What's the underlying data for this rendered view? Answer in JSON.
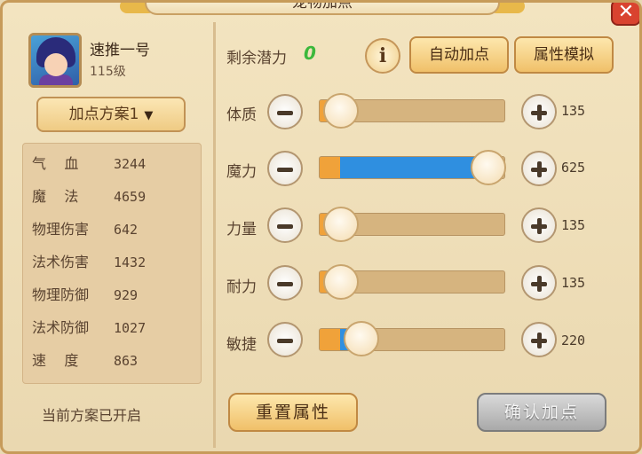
{
  "window": {
    "title": "宠物加点",
    "close_icon": "close-icon"
  },
  "pet": {
    "name": "速推一号",
    "level": "115级"
  },
  "scheme": {
    "label": "加点方案1"
  },
  "stats": [
    {
      "label": "气    血",
      "value": "3244"
    },
    {
      "label": "魔    法",
      "value": "4659"
    },
    {
      "label": "物理伤害",
      "value": "642"
    },
    {
      "label": "法术伤害",
      "value": "1432"
    },
    {
      "label": "物理防御",
      "value": "929"
    },
    {
      "label": "法术防御",
      "value": "1027"
    },
    {
      "label": "速    度",
      "value": "863"
    }
  ],
  "status_text": "当前方案已开启",
  "potential": {
    "label": "剩余潜力",
    "value": "0"
  },
  "buttons": {
    "info": "i",
    "auto": "自动加点",
    "simulate": "属性模拟",
    "reset": "重置属性",
    "confirm": "确认加点"
  },
  "attributes": [
    {
      "label": "体质",
      "value": "135",
      "base_fraction": 0.11,
      "added_fraction": 0.0
    },
    {
      "label": "魔力",
      "value": "625",
      "base_fraction": 0.11,
      "added_fraction": 0.79
    },
    {
      "label": "力量",
      "value": "135",
      "base_fraction": 0.11,
      "added_fraction": 0.0
    },
    {
      "label": "耐力",
      "value": "135",
      "base_fraction": 0.11,
      "added_fraction": 0.0
    },
    {
      "label": "敏捷",
      "value": "220",
      "base_fraction": 0.11,
      "added_fraction": 0.11
    }
  ],
  "colors": {
    "base_fill": "#f0a23a",
    "added_fill": "#2f8fe0",
    "potential_value": "#3cb83c"
  }
}
